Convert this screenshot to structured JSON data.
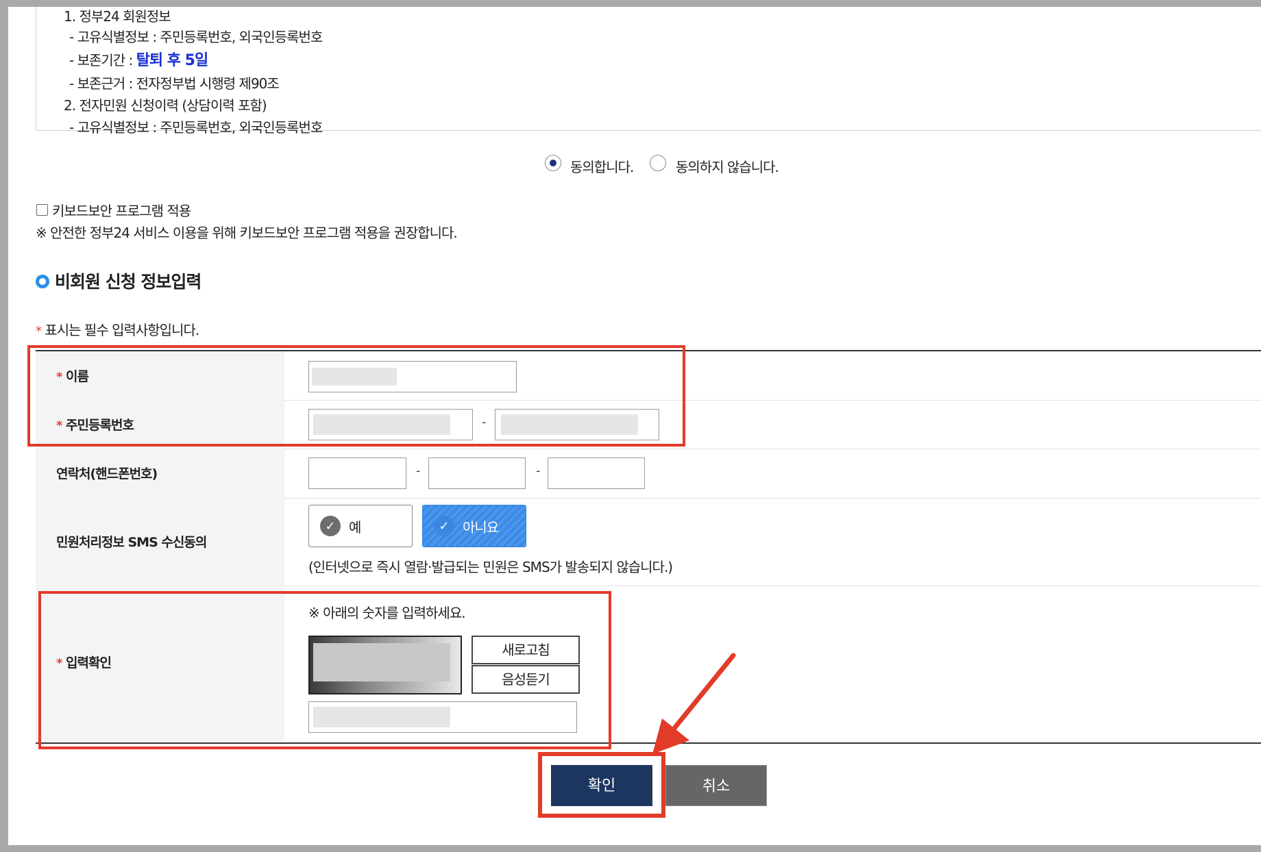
{
  "terms": {
    "lines": [
      "1. 정부24 회원정보",
      "- 고유식별정보 : 주민등록번호, 외국인등록번호",
      "- 보존기간 : ",
      "- 보존근거 : 전자정부법 시행령 제90조",
      "2. 전자민원 신청이력 (상담이력 포함)",
      "- 고유식별정보 : 주민등록번호, 외국인등록번호"
    ],
    "retention_highlight": "탈퇴 후 5일"
  },
  "agree": {
    "yes_label": "동의합니다.",
    "no_label": "동의하지 않습니다.",
    "selected": "yes"
  },
  "keyboard_security": {
    "checkbox_label": "키보드보안 프로그램 적용",
    "note": "※ 안전한 정부24 서비스 이용을 위해 키보드보안 프로그램 적용을 권장합니다."
  },
  "section": {
    "title": "비회원 신청 정보입력",
    "required_note": "표시는 필수 입력사항입니다.",
    "required_mark": "*"
  },
  "form": {
    "name_label": "이름",
    "rrn_label": "주민등록번호",
    "phone_label": "연락처(핸드폰번호)",
    "sms_label": "민원처리정보 SMS 수신동의",
    "sms_yes": "예",
    "sms_no": "아니요",
    "sms_selected": "no",
    "sms_note": "(인터넷으로 즉시 열람·발급되는 민원은 SMS가 발송되지 않습니다.)",
    "captcha_label": "입력확인",
    "captcha_instruction": "※ 아래의 숫자를 입력하세요.",
    "refresh_button": "새로고침",
    "audio_button": "음성듣기",
    "separator": "-"
  },
  "actions": {
    "confirm": "확인",
    "cancel": "취소"
  },
  "colors": {
    "annotation_red": "#e23b2a",
    "confirm_navy": "#1c3660",
    "highlight_blue": "#1a2fd6",
    "sms_selected_blue": "#3d89e4"
  }
}
